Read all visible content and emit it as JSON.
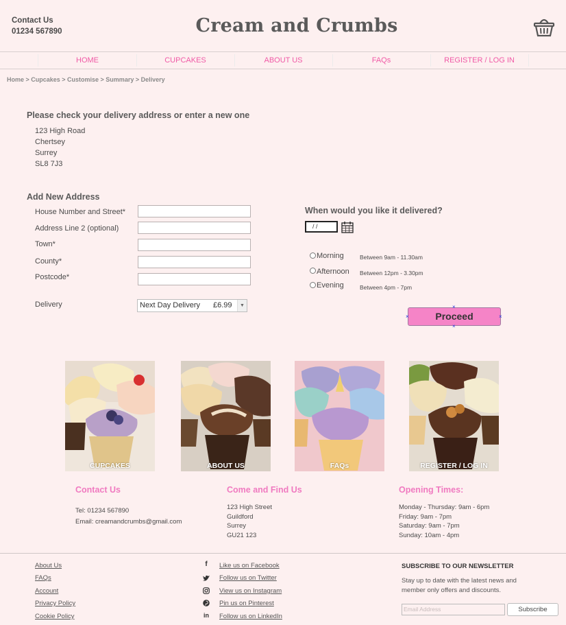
{
  "header": {
    "contact_title": "Contact Us",
    "contact_phone": "01234 567890",
    "brand": "Cream and Crumbs",
    "cart_icon": "basket-icon"
  },
  "nav": [
    "HOME",
    "CUPCAKES",
    "ABOUT US",
    "FAQs",
    "REGISTER / LOG IN"
  ],
  "breadcrumb": "Home > Cupcakes > Customise > Summary > Delivery",
  "address_check": {
    "heading": "Please check your delivery address or enter a new one",
    "lines": [
      "123 High Road",
      "Chertsey",
      "Surrey",
      "SL8 7J3"
    ]
  },
  "new_address": {
    "heading": "Add New Address",
    "fields": [
      {
        "label": "House Number and Street*",
        "value": ""
      },
      {
        "label": "Address Line 2 (optional)",
        "value": ""
      },
      {
        "label": "Town*",
        "value": ""
      },
      {
        "label": "County*",
        "value": ""
      },
      {
        "label": "Postcode*",
        "value": ""
      }
    ],
    "delivery_label": "Delivery",
    "delivery_option": "Next Day Delivery",
    "delivery_price": "£6.99"
  },
  "delivery_time": {
    "heading": "When would you like it delivered?",
    "date_value": "/ /",
    "calendar_icon": "calendar-icon",
    "options": [
      {
        "label": "Morning",
        "time": "Between 9am - 11.30am"
      },
      {
        "label": "Afternoon",
        "time": "Between 12pm - 3.30pm"
      },
      {
        "label": "Evening",
        "time": "Between 4pm - 7pm"
      }
    ],
    "proceed_label": "Proceed"
  },
  "tiles": [
    "CUPCAKES",
    "ABOUT US",
    "FAQs",
    "REGISTER / LOG IN"
  ],
  "info": {
    "contact": {
      "heading": "Contact Us",
      "tel": "Tel: 01234 567890",
      "email": "Email: creamandcrumbs@gmail.com"
    },
    "location": {
      "heading": "Come and Find Us",
      "lines": [
        "123 High Street",
        "Guildford",
        "Surrey",
        "GU21 123"
      ]
    },
    "hours": {
      "heading": "Opening Times:",
      "lines": [
        "Monday - Thursday: 9am - 6pm",
        "Friday: 9am - 7pm",
        "Saturday: 9am - 7pm",
        "Sunday: 10am - 4pm"
      ]
    }
  },
  "footer": {
    "links": [
      "About Us",
      "FAQs",
      "Account",
      "Privacy Policy",
      "Cookie Policy"
    ],
    "social": [
      {
        "icon": "facebook-icon",
        "glyph": "f",
        "label": "Like us on Facebook"
      },
      {
        "icon": "twitter-icon",
        "glyph": "t",
        "label": "Follow us on Twitter"
      },
      {
        "icon": "instagram-icon",
        "glyph": "◎",
        "label": "View us on Instagram"
      },
      {
        "icon": "pinterest-icon",
        "glyph": "℗",
        "label": "Pin us on Pinterest"
      },
      {
        "icon": "linkedin-icon",
        "glyph": "in",
        "label": "Follow us on LinkedIn"
      }
    ],
    "newsletter_heading": "SUBSCRIBE TO OUR NEWSLETTER",
    "newsletter_text": "Stay up to date with the latest news and member only offers and discounts.",
    "email_placeholder": "Email Address",
    "subscribe_label": "Subscribe"
  },
  "colors": {
    "accent": "#f05aa6",
    "button": "#f584c7",
    "background": "#fdf0f0"
  }
}
